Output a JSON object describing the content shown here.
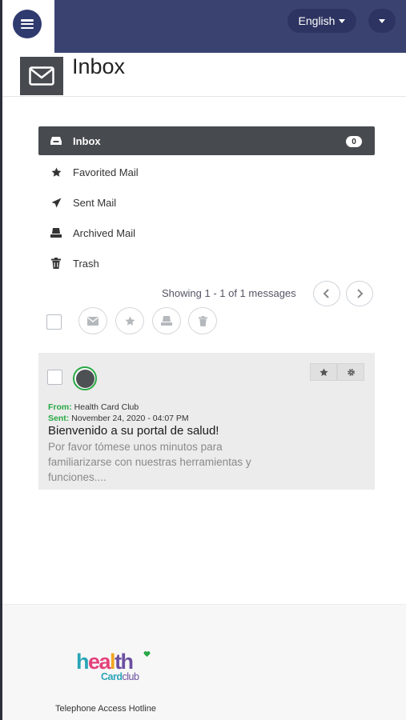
{
  "header": {
    "language_label": "English"
  },
  "title": {
    "text": "Inbox"
  },
  "folders": [
    {
      "label": "Inbox",
      "count": "0",
      "icon": "inbox-icon",
      "active": true
    },
    {
      "label": "Favorited Mail",
      "icon": "star-icon"
    },
    {
      "label": "Sent Mail",
      "icon": "send-icon"
    },
    {
      "label": "Archived Mail",
      "icon": "archive-icon"
    },
    {
      "label": "Trash",
      "icon": "trash-icon"
    }
  ],
  "pagination": {
    "showing_text": "Showing 1 - 1 of 1 messages"
  },
  "toolbar_actions": [
    "envelope-icon",
    "star-icon",
    "archive-icon",
    "trash-icon"
  ],
  "message": {
    "from_label": "From:",
    "from_value": "Health Card Club",
    "sent_label": "Sent:",
    "sent_value": "November 24, 2020 - 04:07 PM",
    "subject": "Bienvenido a su portal de salud!",
    "preview": "Por favor tómese unos minutos para familiarizarse con nuestras herramientas y funciones....",
    "avatar_ring_color": "#27a844"
  },
  "footer": {
    "logo_main": "health",
    "logo_sub_a": "Card",
    "logo_sub_b": "club",
    "hotline": "Telephone Access Hotline"
  },
  "colors": {
    "topbar": "#3a4270",
    "active_folder": "#474a4f",
    "accent_green": "#27a844"
  }
}
